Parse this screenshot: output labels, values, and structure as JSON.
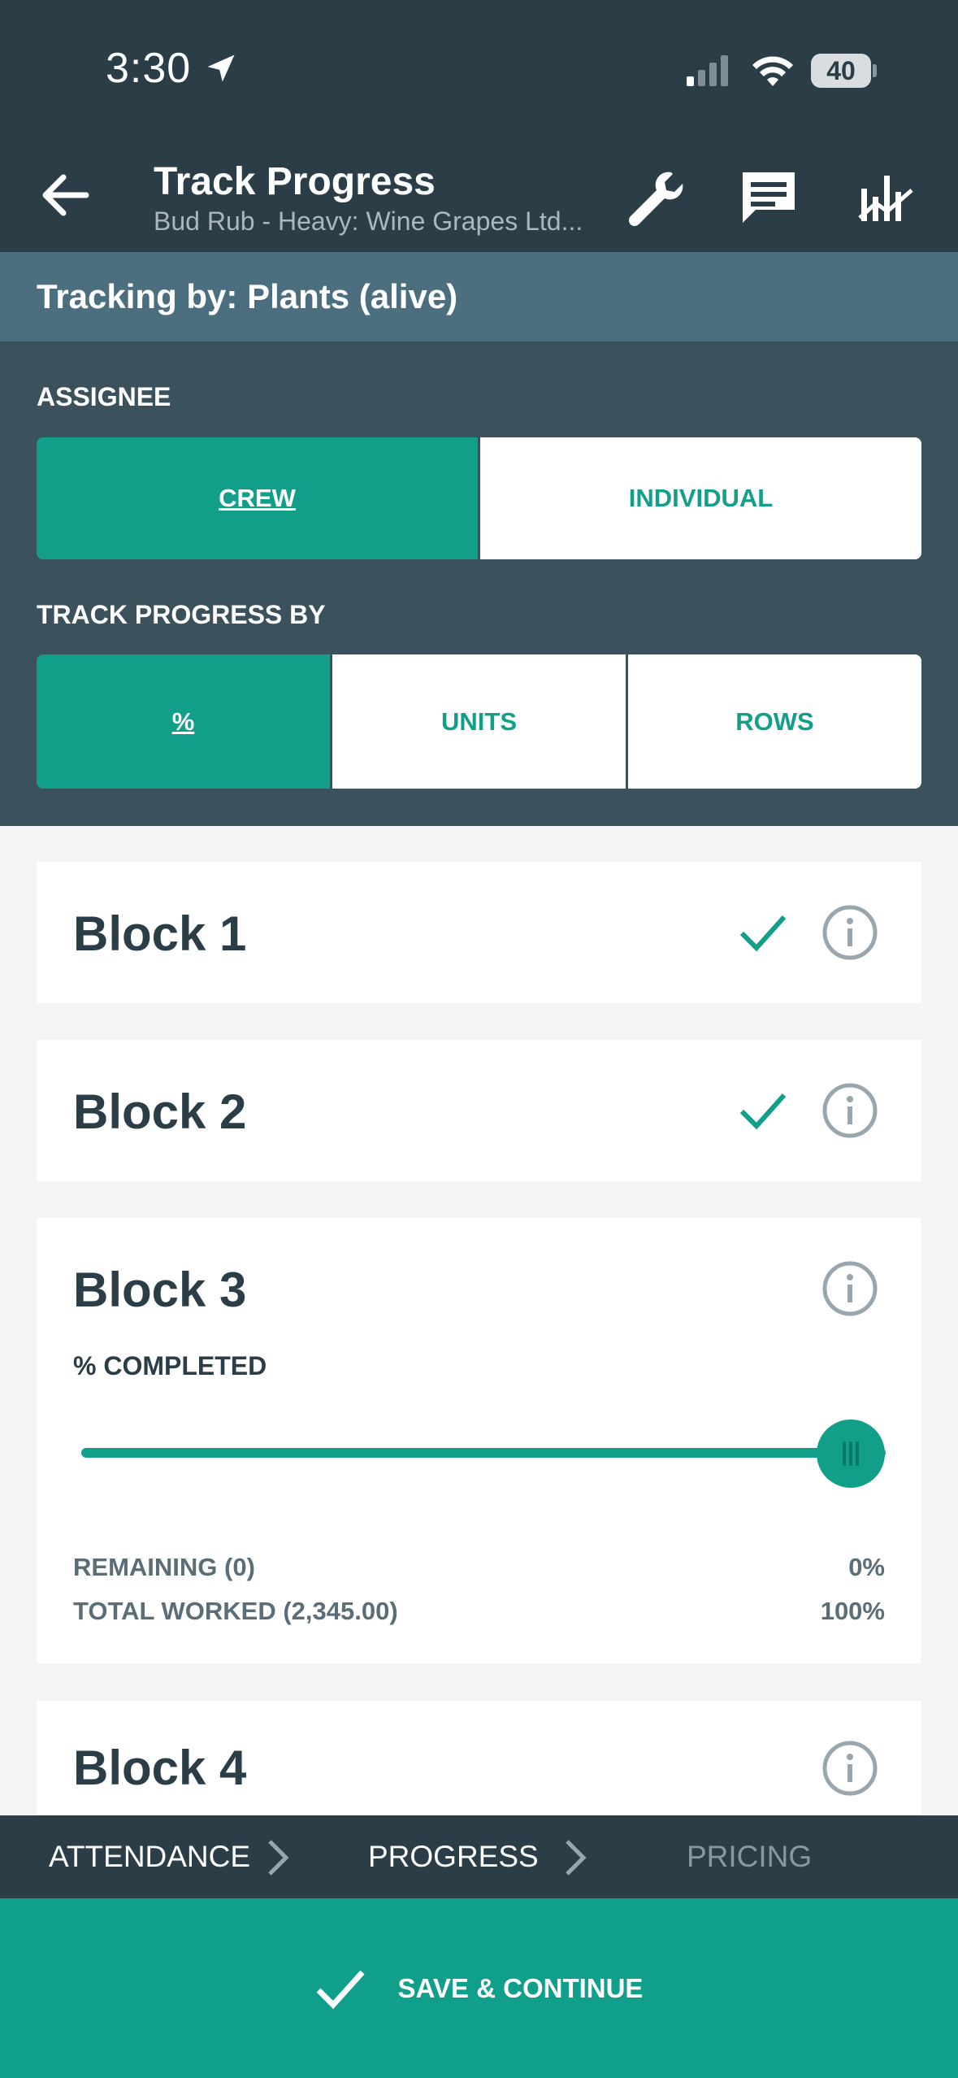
{
  "status_bar": {
    "time": "3:30",
    "battery": "40"
  },
  "header": {
    "title": "Track Progress",
    "subtitle": "Bud Rub - Heavy: Wine Grapes Ltd...",
    "icons": [
      "back-arrow-icon",
      "wrench-icon",
      "chat-icon",
      "chart-icon"
    ]
  },
  "tracking": {
    "label": "Tracking by: Plants (alive)"
  },
  "assignee": {
    "label": "ASSIGNEE",
    "options": [
      "CREW",
      "INDIVIDUAL"
    ],
    "selected": "CREW"
  },
  "track_by": {
    "label": "TRACK PROGRESS BY",
    "options": [
      "%",
      "UNITS",
      "ROWS"
    ],
    "selected": "%"
  },
  "blocks": [
    {
      "name": "Block 1",
      "completed": true
    },
    {
      "name": "Block 2",
      "completed": true
    },
    {
      "name": "Block 3",
      "completed": false,
      "pct_label": "% COMPLETED",
      "slider_value_percent": 100,
      "remaining_label": "REMAINING (0)",
      "remaining_value": "0%",
      "total_label": "TOTAL WORKED (2,345.00)",
      "total_value": "100%"
    },
    {
      "name": "Block 4",
      "completed": false
    }
  ],
  "steps": {
    "items": [
      "ATTENDANCE",
      "PROGRESS",
      "PRICING"
    ],
    "active": "PROGRESS"
  },
  "save_button": {
    "label": "SAVE & CONTINUE"
  },
  "colors": {
    "header_bg": "#2b3e48",
    "accent": "#129f8a",
    "tracking_bar": "#4c6f7f",
    "filters_bg": "#3b515c"
  }
}
